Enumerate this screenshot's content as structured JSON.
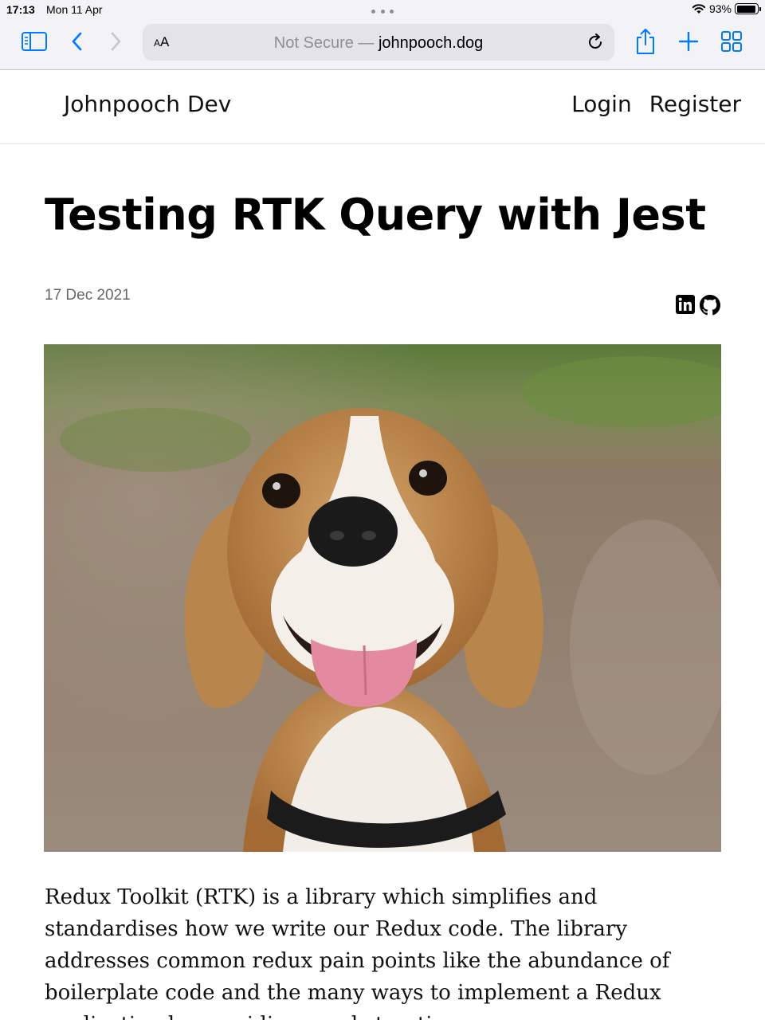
{
  "status_bar": {
    "time": "17:13",
    "date": "Mon 11 Apr",
    "battery": "93%",
    "battery_level": 0.93
  },
  "browser": {
    "text_size_label": "AA",
    "security_label": "Not Secure —",
    "host": "johnpooch.dog",
    "icons": [
      "sidebar-icon",
      "back-icon",
      "forward-icon",
      "reload-icon",
      "share-icon",
      "new-tab-icon",
      "tabs-overview-icon"
    ]
  },
  "site": {
    "brand": "Johnpooch Dev",
    "nav": {
      "login": "Login",
      "register": "Register"
    }
  },
  "article": {
    "title": "Testing RTK Query with Jest",
    "date": "17 Dec 2021",
    "social_icons": [
      "linkedin-icon",
      "github-icon"
    ],
    "intro": "Redux Toolkit (RTK) is a library which simplifies and standardises how we write our Redux code. The library addresses common redux pain points like the abundance of boilerplate code and the many ways to implement a Redux application by providing an abstraction over"
  },
  "colors": {
    "accent": "#007aff",
    "chrome_bg": "#f2f2f7",
    "address_bg": "#e3e3e8"
  }
}
